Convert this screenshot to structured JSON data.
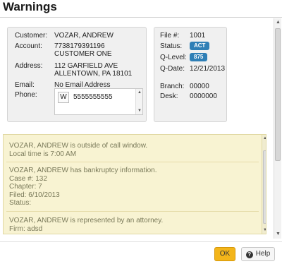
{
  "dialog": {
    "title": "Warnings"
  },
  "account_panel": {
    "customer_label": "Customer:",
    "customer_value": "VOZAR, ANDREW",
    "account_label": "Account:",
    "account_number": "7738179391196",
    "account_name": "CUSTOMER ONE",
    "address_label": "Address:",
    "address_line1": "112 GARFIELD AVE",
    "address_line2": "ALLENTOWN, PA 18101",
    "email_label": "Email:",
    "email_value": "No Email Address",
    "phone_label": "Phone:",
    "phone_type": "W",
    "phone_number": "5555555555"
  },
  "file_panel": {
    "file_label": "File #:",
    "file_value": "1001",
    "status_label": "Status:",
    "status_value": "ACT",
    "qlevel_label": "Q-Level:",
    "qlevel_value": "875",
    "qdate_label": "Q-Date:",
    "qdate_value": "12/21/2013",
    "branch_label": "Branch:",
    "branch_value": "00000",
    "desk_label": "Desk:",
    "desk_value": "0000000",
    "badge_color": "#2f7fb6"
  },
  "warnings": [
    {
      "lines": [
        "VOZAR, ANDREW is outside of call window.",
        "Local time is 7:00 AM"
      ]
    },
    {
      "lines": [
        "VOZAR, ANDREW has bankruptcy information.",
        "Case #: 132",
        "Chapter: 7",
        "Filed: 6/10/2013",
        "Status:"
      ]
    },
    {
      "lines": [
        "VOZAR, ANDREW is represented by an attorney.",
        "Firm: adsd"
      ]
    }
  ],
  "buttons": {
    "ok_label": "OK",
    "help_label": "Help",
    "ok_color": "#f3b51a"
  },
  "icons": {
    "help": "help-icon",
    "scroll_up": "up-arrow-icon",
    "scroll_down": "down-arrow-icon"
  }
}
